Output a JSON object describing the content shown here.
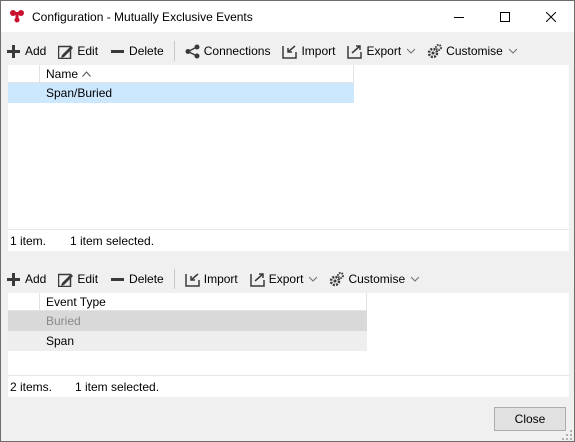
{
  "window": {
    "title": "Configuration - Mutually Exclusive Events",
    "brand_color": "#c8102e"
  },
  "toolbar_top": {
    "add": "Add",
    "edit": "Edit",
    "delete": "Delete",
    "connections": "Connections",
    "import": "Import",
    "export": "Export",
    "customise": "Customise"
  },
  "grid_top": {
    "column": "Name",
    "rows": [
      "Span/Buried"
    ]
  },
  "status_top": {
    "count": "1 item.",
    "selected": "1 item selected."
  },
  "toolbar_bottom": {
    "add": "Add",
    "edit": "Edit",
    "delete": "Delete",
    "import": "Import",
    "export": "Export",
    "customise": "Customise"
  },
  "grid_bottom": {
    "column": "Event Type",
    "rows": [
      "Buried",
      "Span"
    ]
  },
  "status_bottom": {
    "count": "2 items.",
    "selected": "1 item selected."
  },
  "footer": {
    "close": "Close"
  },
  "colors": {
    "selection": "#cce8ff",
    "disabled_row": "#d9d9d9"
  }
}
